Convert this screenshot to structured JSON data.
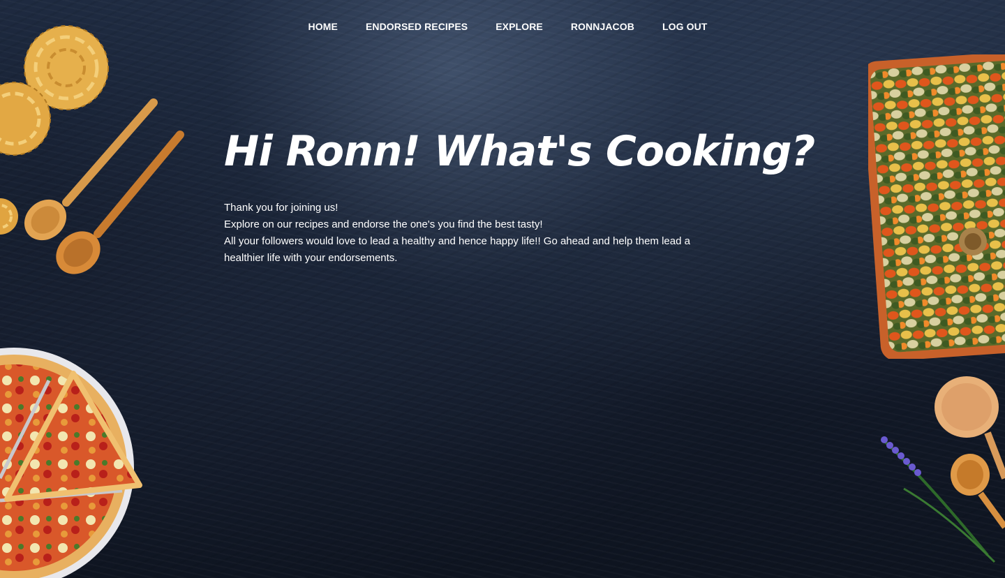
{
  "nav": {
    "items": [
      {
        "label": "HOME",
        "name": "nav-home"
      },
      {
        "label": "ENDORSED RECIPES",
        "name": "nav-endorsed-recipes"
      },
      {
        "label": "EXPLORE",
        "name": "nav-explore"
      },
      {
        "label": "RONNJACOB",
        "name": "nav-profile"
      },
      {
        "label": "LOG OUT",
        "name": "nav-log-out"
      }
    ]
  },
  "hero": {
    "title": "Hi Ronn! What's Cooking?",
    "lines": [
      "Thank you for joining us!",
      "Explore on our recipes and endorse the one's you find the best tasty!",
      "All your followers would love to lead a healthy and hence happy life!! Go ahead and help them lead a healthier life with your endorsements."
    ]
  },
  "decor": {
    "icons": [
      "pasta-nest-icon",
      "wooden-spoon-icon",
      "pasta-tray-icon",
      "pizza-icon",
      "lavender-icon"
    ]
  },
  "colors": {
    "background": "#141c2c",
    "text": "#ffffff",
    "wood": "#d08a3a",
    "pasta": "#e9b64f"
  }
}
